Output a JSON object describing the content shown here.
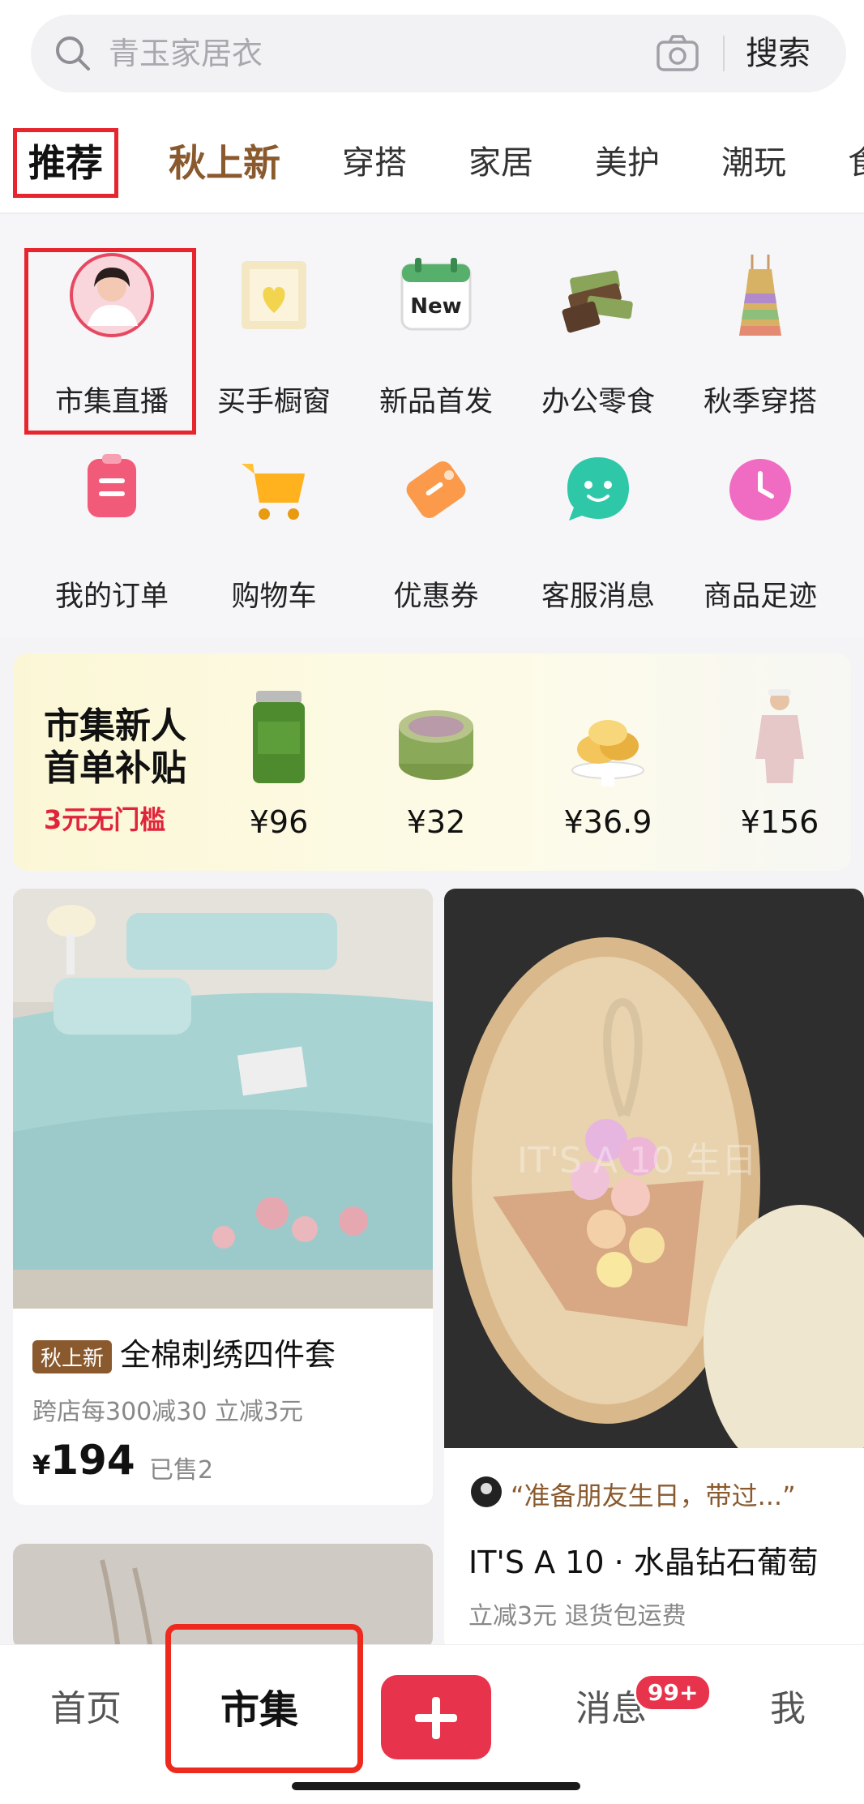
{
  "search": {
    "placeholder": "青玉家居衣",
    "button": "搜索"
  },
  "tabs": [
    "推荐",
    "秋上新",
    "穿搭",
    "家居",
    "美护",
    "潮玩",
    "食"
  ],
  "shortcuts_row1": [
    "市集直播",
    "买手橱窗",
    "新品首发",
    "办公零食",
    "秋季穿搭"
  ],
  "shortcuts_row2": [
    "我的订单",
    "购物车",
    "优惠券",
    "客服消息",
    "商品足迹"
  ],
  "icon_new_text": "New",
  "promo": {
    "title_line1": "市集新人",
    "title_line2": "首单补贴",
    "subtitle": "3元无门槛",
    "prices": [
      "¥96",
      "¥32",
      "¥36.9",
      "¥156"
    ]
  },
  "card1": {
    "badge": "秋上新",
    "title": "全棉刺绣四件套",
    "meta": "跨店每300减30   立减3元",
    "currency": "¥",
    "price": "194",
    "sold": "已售2"
  },
  "card2": {
    "quote": "“准备朋友生日，带过...”",
    "watermark": "IT'S A 10 生日",
    "title": "IT'S A 10 · 水晶钻石葡萄",
    "meta": "立减3元   退货包运费"
  },
  "bottom_nav": {
    "home": "首页",
    "market": "市集",
    "messages": "消息",
    "messages_badge": "99+",
    "me": "我"
  },
  "colors": {
    "accent": "#e8334d",
    "highlight": "#e6252e",
    "autumn": "#8a5a2e"
  }
}
